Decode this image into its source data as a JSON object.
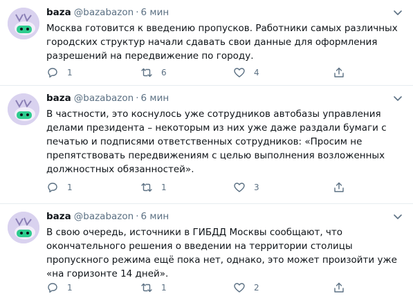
{
  "tweets": [
    {
      "name": "baza",
      "handle": "@bazabazon",
      "time": "6 мин",
      "text": "Москва готовится к введению пропусков. Работники самых различных городских структур начали сдавать свои данные для оформления разрешений на передвижение по городу.",
      "replies": "1",
      "retweets": "6",
      "likes": "4"
    },
    {
      "name": "baza",
      "handle": "@bazabazon",
      "time": "6 мин",
      "text": "В частности, это коснулось уже сотрудников автобазы управления делами президента – некоторым из них уже даже раздали бумаги с печатью и подписями ответственных сотрудников: «Просим не препятствовать передвижениям с целью выполнения возложенных должностных обязанностей».",
      "replies": "1",
      "retweets": "1",
      "likes": "3"
    },
    {
      "name": "baza",
      "handle": "@bazabazon",
      "time": "6 мин",
      "text": "В свою очередь, источники в ГИБДД Москвы сообщают, что окончательного решения о введении на территории столицы пропускного режима ещё пока нет, однако, это может произойти уже «на горизонте 14 дней».",
      "replies": "1",
      "retweets": "1",
      "likes": "2"
    }
  ],
  "colors": {
    "text": "#0f1419",
    "secondary": "#5b7083",
    "divider": "#e6ecf0",
    "avatar_bg": "#d9d2ef",
    "avatar_face": "#2ecc8f"
  },
  "icons": [
    "reply-icon",
    "retweet-icon",
    "like-icon",
    "share-icon",
    "more-icon"
  ]
}
